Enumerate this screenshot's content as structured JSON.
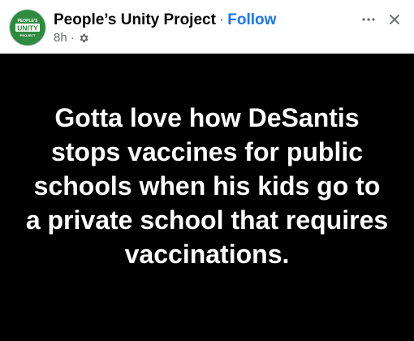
{
  "post": {
    "page_name": "People’s Unity Project",
    "separator": "·",
    "follow_label": "Follow",
    "timestamp": "8h",
    "dot": "·",
    "audience_icon": "gear-icon",
    "more_icon": "more-options-icon",
    "close_icon": "close-icon",
    "text": "Gotta love how DeSantis stops vaccines for public schools when his kids go to a private school that requires vaccinations.",
    "background_color": "#000000",
    "text_color": "#ffffff"
  },
  "avatar": {
    "top_text": "PEOPLE'S",
    "main_text": "UNITY",
    "bottom_text": "PROJECT",
    "color": "#2e8b3f"
  },
  "colors": {
    "follow": "#1877f2",
    "secondary": "#65676b"
  }
}
